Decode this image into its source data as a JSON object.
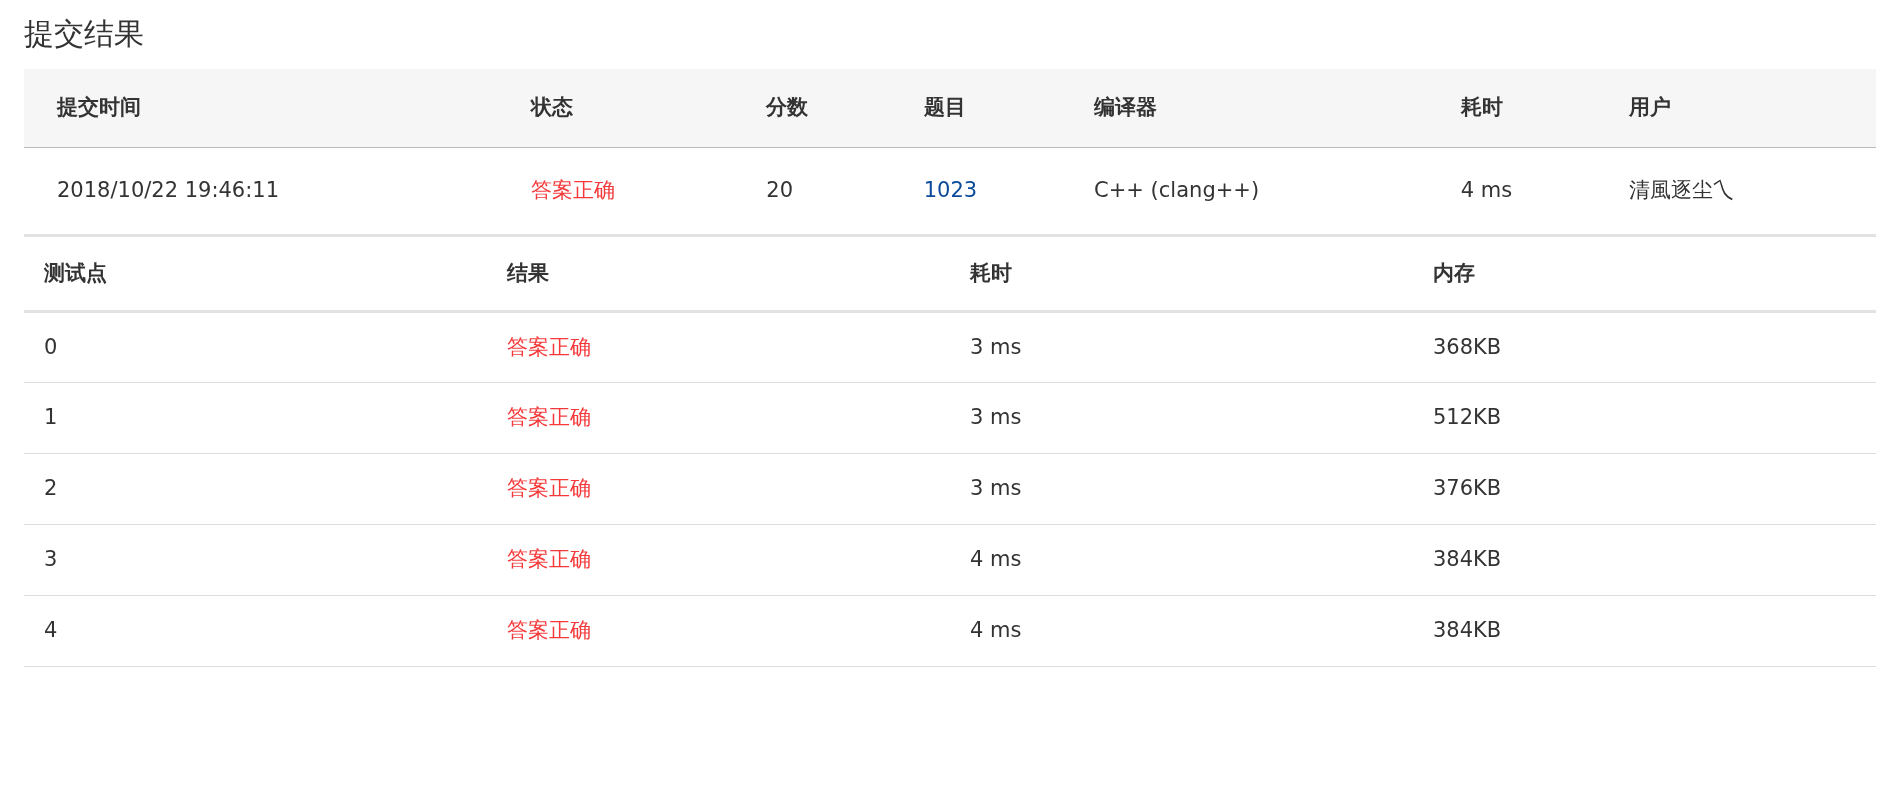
{
  "title": "提交结果",
  "submission": {
    "columns": [
      "提交时间",
      "状态",
      "分数",
      "题目",
      "编译器",
      "耗时",
      "用户"
    ],
    "row": {
      "time": "2018/10/22 19:46:11",
      "status": "答案正确",
      "score": "20",
      "problem": "1023",
      "compiler": "C++ (clang++)",
      "elapsed": "4 ms",
      "user": "清風逐尘乀"
    }
  },
  "cases": {
    "columns": [
      "测试点",
      "结果",
      "耗时",
      "内存"
    ],
    "rows": [
      {
        "id": "0",
        "result": "答案正确",
        "time": "3 ms",
        "memory": "368KB"
      },
      {
        "id": "1",
        "result": "答案正确",
        "time": "3 ms",
        "memory": "512KB"
      },
      {
        "id": "2",
        "result": "答案正确",
        "time": "3 ms",
        "memory": "376KB"
      },
      {
        "id": "3",
        "result": "答案正确",
        "time": "4 ms",
        "memory": "384KB"
      },
      {
        "id": "4",
        "result": "答案正确",
        "time": "4 ms",
        "memory": "384KB"
      }
    ]
  }
}
